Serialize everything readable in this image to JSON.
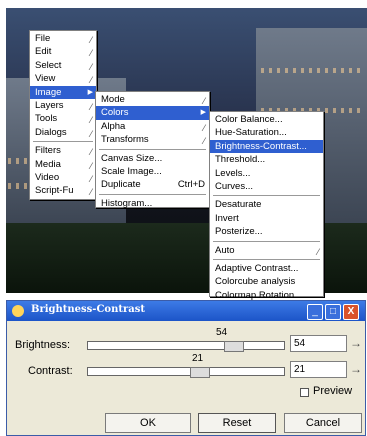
{
  "image_menu": {
    "items": [
      "File",
      "Edit",
      "Select",
      "View",
      "Image",
      "Layers",
      "Tools",
      "Dialogs",
      "Filters",
      "Media",
      "Video",
      "Script-Fu"
    ],
    "selected": "Image"
  },
  "image_submenu": {
    "items": [
      "Mode",
      "Colors",
      "Alpha",
      "Transforms",
      "Canvas Size...",
      "Scale Image...",
      "Duplicate",
      "Histogram..."
    ],
    "selected": "Colors",
    "duplicate_shortcut": "Ctrl+D"
  },
  "colors_submenu": {
    "items": [
      "Color Balance...",
      "Hue-Saturation...",
      "Brightness-Contrast...",
      "Threshold...",
      "Levels...",
      "Curves...",
      "Desaturate",
      "Invert",
      "Posterize...",
      "Auto",
      "Adaptive Contrast...",
      "Colorcube analysis",
      "Colormap Rotation..."
    ],
    "selected": "Brightness-Contrast..."
  },
  "dialog": {
    "title": "Brightness-Contrast",
    "brightness_label": "Brightness:",
    "brightness_value": "54",
    "brightness_field": "54",
    "contrast_label": "Contrast:",
    "contrast_value": "21",
    "contrast_field": "21",
    "preview_label": "Preview",
    "ok_label": "OK",
    "reset_label": "Reset",
    "cancel_label": "Cancel",
    "minimize_glyph": "_",
    "maximize_glyph": "□",
    "close_glyph": "X"
  },
  "colors": {
    "selection": "#2f5fd0",
    "titlebar": "#1c54c8",
    "close": "#d9522b"
  }
}
